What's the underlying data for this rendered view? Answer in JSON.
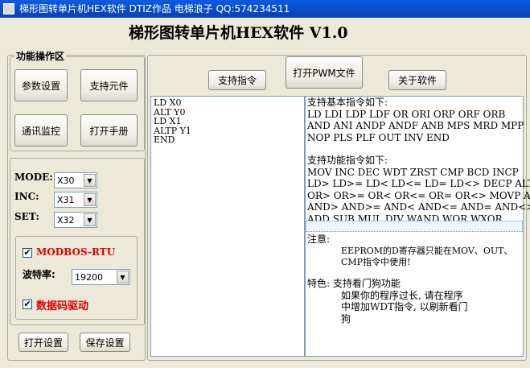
{
  "window": {
    "title": "梯形图转单片机HEX软件  DTIZ作品  电梯浪子 QQ:574234511"
  },
  "app": {
    "title": "梯形图转单片机HEX软件 V1.0"
  },
  "func_group": {
    "label": "功能操作区",
    "buttons": {
      "params": "参数设置",
      "components": "支持元件",
      "monitor": "通讯监控",
      "manual": "打开手册"
    }
  },
  "settings": {
    "mode_label": "MODE:",
    "mode_value": "X30",
    "inc_label": "INC:",
    "inc_value": "X31",
    "set_label": "SET:",
    "set_value": "X32"
  },
  "comm": {
    "modbus_label": "MODBOS-RTU",
    "modbus_checked": true,
    "baud_label": "波特率:",
    "baud_value": "19200",
    "data_label": "数据码驱动",
    "data_checked": true
  },
  "bottom_buttons": {
    "open_settings": "打开设置",
    "save_settings": "保存设置"
  },
  "toolbar": {
    "instructions": "支持指令",
    "open_pwm": "打开PWM文件",
    "about": "关于软件"
  },
  "code": [
    "LD X0",
    "ALT Y0",
    "LD X1",
    "ALTP Y1",
    "END"
  ],
  "help": {
    "basic_title": "支持基本指令如下:",
    "basic_lines": [
      "LD LDI LDP LDF OR ORI ORP ORF ORB",
      "AND ANI ANDP ANDF ANB MPS MRD MPP",
      "NOP PLS PLF OUT INV END"
    ],
    "func_title": "支持功能指令如下:",
    "func_lines": [
      "MOV INC DEC WDT ZRST CMP BCD INCP",
      "LD> LD>= LD< LD<= LD= LD<> DECP ALT",
      "OR> OR>= OR< OR<= OR= OR<> MOVP ALTP",
      "AND> AND>= AND< AND<= AND= AND<>",
      "ADD SUB MUL DIV WAND WOR WXOR"
    ],
    "note_title": "注意:",
    "note_lines": [
      "EEPROM的D寄存器只能在MOV、OUT、",
      "CMP指令中使用!"
    ],
    "feature_title": "特色: 支持看门狗功能",
    "feature_lines": [
      "如果你的程序过长, 请在程序",
      "中增加WDT指令, 以刷新看门",
      "狗"
    ]
  },
  "icons": {
    "checkmark": "✔",
    "dropdown": "▼"
  }
}
